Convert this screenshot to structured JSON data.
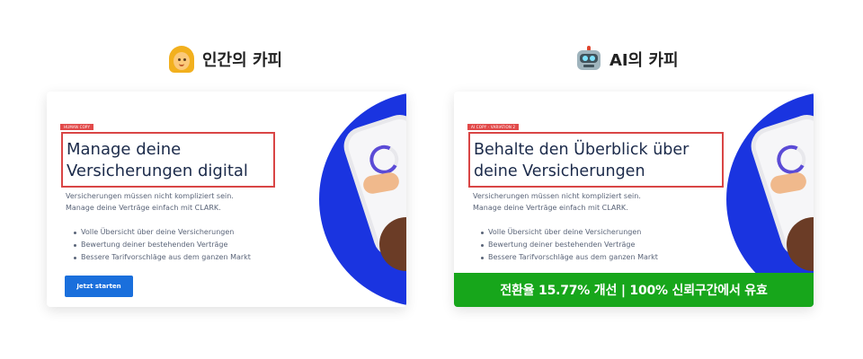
{
  "human": {
    "title": "인간의 카피",
    "tag": "HUMAN COPY",
    "headline_line1": "Manage deine",
    "headline_line2": "Versicherungen digital",
    "intro_line1": "Versicherungen müssen nicht kompliziert sein.",
    "intro_line2": "Manage deine Verträge einfach mit CLARK.",
    "bullets": [
      "Volle Übersicht über deine Versicherungen",
      "Bewertung deiner bestehenden Verträge",
      "Bessere Tarifvorschläge aus dem ganzen Markt"
    ],
    "cta_label": "Jetzt starten"
  },
  "ai": {
    "title": "AI의 카피",
    "tag": "AI COPY - VARIATION 2",
    "headline_line1": "Behalte den Überblick über",
    "headline_line2": "deine Versicherungen",
    "intro_line1": "Versicherungen müssen nicht kompliziert sein.",
    "intro_line2": "Manage deine Verträge einfach mit CLARK.",
    "bullets": [
      "Volle Übersicht über deine Versicherungen",
      "Bewertung deiner bestehenden Verträge",
      "Bessere Tarifvorschläge aus dem ganzen Markt"
    ],
    "result": "전환율 15.77% 개선  |  100% 신뢰구간에서 유효"
  },
  "icons": {
    "human": "woman-icon",
    "ai": "robot-icon"
  },
  "colors": {
    "accent_blue": "#1a34e0",
    "cta_blue": "#1a6fdc",
    "highlight_red": "#d94545",
    "result_green": "#17a61b"
  }
}
